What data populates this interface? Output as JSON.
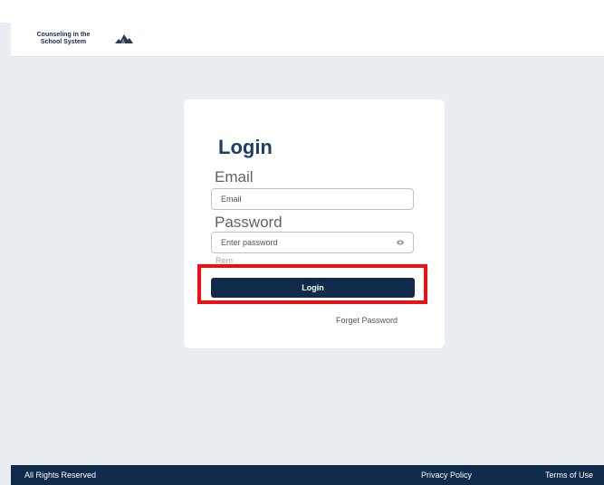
{
  "header": {
    "brand_line1": "Counseling in the",
    "brand_line2": "School System",
    "logo_icon": "building-icon"
  },
  "login": {
    "title": "Login",
    "email_label": "Email",
    "email_placeholder": "Email",
    "password_label": "Password",
    "password_placeholder": "Enter password",
    "password_toggle_icon": "eye-icon",
    "remember_partial": "Rem",
    "button_label": "Login",
    "forgot_link": "Forget Password"
  },
  "footer": {
    "rights": "All Rights Reserved",
    "privacy": "Privacy Policy",
    "terms": "Terms of Use"
  },
  "colors": {
    "brand_navy": "#0f2a4a",
    "title_blue": "#1d3f66",
    "highlight_red": "#ef0f12",
    "page_bg": "#e9eef2"
  }
}
